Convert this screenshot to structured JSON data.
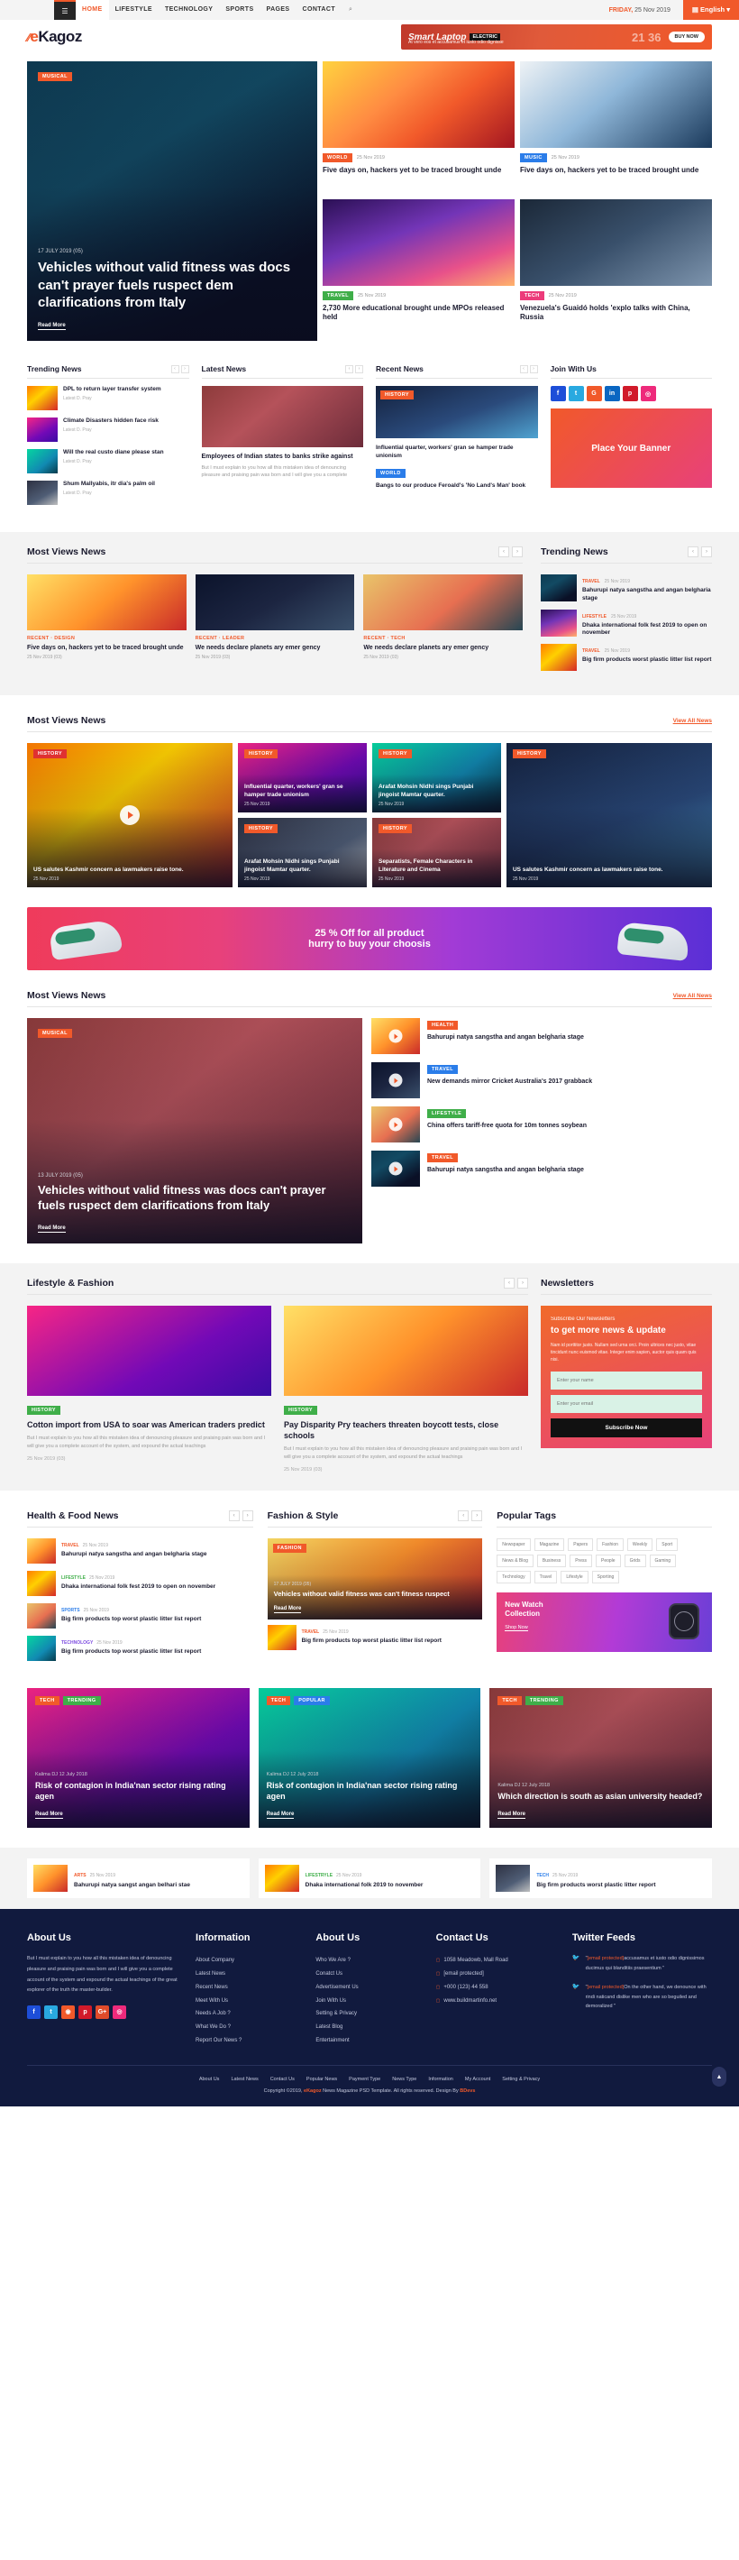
{
  "topbar": {
    "nav": [
      "HOME",
      "LIFESTYLE",
      "TECHNOLOGY",
      "SPORTS",
      "PAGES",
      "CONTACT"
    ],
    "search_icon": "search-icon",
    "date_day": "FRIDAY,",
    "date_rest": " 25 Nov 2019",
    "language": "English"
  },
  "header": {
    "logo_e": "e",
    "logo_rest": "Kagoz",
    "ad": {
      "title": "Smart Laptop",
      "chip": "ELECTRIC",
      "subtitle": "At vero eos et accusamus et iusto odio dignisse",
      "number": "21 36",
      "button": "BUY NOW"
    }
  },
  "hero": {
    "category": "MUSICAL",
    "meta": "17 JULY 2019   (05)",
    "title": "Vehicles without valid fitness was docs can't prayer fuels ruspect dem clarifications from Italy",
    "read_more": "Read More"
  },
  "hero_cards": [
    {
      "category": "WORLD",
      "cat_class": "c-or",
      "date": "25 Nov 2019",
      "title": "Five days on, hackers yet to be traced brought unde",
      "img": "g2"
    },
    {
      "category": "MUSIC",
      "cat_class": "c-bl",
      "date": "25 Nov 2019",
      "title": "Five days on, hackers yet to be traced brought unde",
      "img": "g3"
    },
    {
      "category": "TRAVEL",
      "cat_class": "c-gr",
      "date": "25 Nov 2019",
      "title": "2,730 More educational brought unde MPOs released held",
      "img": "g4"
    },
    {
      "category": "TECH",
      "cat_class": "c-pk",
      "date": "25 Nov 2019",
      "title": "Venezuela's Guaidó holds 'explo talks with China, Russia",
      "img": "g5"
    }
  ],
  "columns": {
    "trending": {
      "title": "Trending News",
      "items": [
        {
          "title": "DPL to return layer transfer system",
          "date": "Latest D. Pray",
          "img": "g6"
        },
        {
          "title": "Climate Disasters hidden face risk",
          "date": "Latest D. Pray",
          "img": "g7"
        },
        {
          "title": "Will the real custo diane please stan",
          "date": "Latest D. Pray",
          "img": "g8"
        },
        {
          "title": "Shum Mallyabis, itr dia's palm oil",
          "date": "Latest D. Pray",
          "img": "g9"
        }
      ]
    },
    "latest": {
      "title": "Latest News",
      "image": "g10",
      "title_text": "Employees of Indian states to banks strike against",
      "desc": "But I must explain to you how all this mistaken idea of denouncing pleasure and praising pain was born and I will give you a complete"
    },
    "recent": {
      "title": "Recent News",
      "image": "g11",
      "category": "HISTORY",
      "cat_class": "c-or",
      "title_text": "Influential quarter, workers' gran se hamper trade unionism",
      "sub_category": "WORLD",
      "sub_cat_class": "c-bl",
      "sub_title": "Bangs to our produce Feroald's 'No Land's Man' book"
    },
    "join": {
      "title": "Join With Us",
      "socials": [
        "f",
        "t",
        "g",
        "in",
        "p",
        "r"
      ],
      "banner": "Place Your Banner"
    }
  },
  "most_views_grey": {
    "title": "Most Views News",
    "items": [
      {
        "img": "g12",
        "cat": "RECENT · DESIGN",
        "title": "Five days on, hackers yet to be traced brought unde",
        "meta": "25 Nov 2019   (03)"
      },
      {
        "img": "g13",
        "cat": "RECENT · LEADER",
        "title": "We needs declare planets ary emer gency",
        "meta": "25 Nov 2019   (03)"
      },
      {
        "img": "g14",
        "cat": "RECENT · TECH",
        "title": "We needs declare planets ary emer gency",
        "meta": "25 Nov 2019   (03)"
      }
    ],
    "trending_title": "Trending News",
    "trending": [
      {
        "img": "g1",
        "cat": "TRAVEL",
        "date": "25 Nov 2019",
        "title": "Bahurupi natya sangstha and angan belgharia stage"
      },
      {
        "img": "g4",
        "cat": "LIFESTYLE",
        "date": "25 Nov 2019",
        "title": "Dhaka international folk fest 2019 to open on november"
      },
      {
        "img": "g6",
        "cat": "TRAVEL",
        "date": "25 Nov 2019",
        "title": "Big firm products worst plastic litter list report"
      }
    ]
  },
  "mosaic": {
    "title": "Most Views News",
    "view_all": "View All News",
    "tiles": [
      {
        "img": "g6",
        "cat": "HISTORY",
        "cat_class": "c-rd",
        "title": "US salutes Kashmir concern as lawmakers raise tone.",
        "date": "25 Nov 2019",
        "play": true
      },
      {
        "img": "g7",
        "cat": "HISTORY",
        "cat_class": "c-or",
        "title": "Influential quarter, workers' gran se hamper trade unionism",
        "date": "25 Nov 2019"
      },
      {
        "img": "g8",
        "cat": "HISTORY",
        "cat_class": "c-or",
        "title": "Arafat Mohsin Nidhi sings Punjabi jingoist Mamtar quarter.",
        "date": "25 Nov 2019"
      },
      {
        "img": "g9",
        "cat": "HISTORY",
        "cat_class": "c-or",
        "title": "Arafat Mohsin Nidhi sings Punjabi jingoist Mamtar quarter.",
        "date": "25 Nov 2019"
      },
      {
        "img": "g10",
        "cat": "HISTORY",
        "cat_class": "c-or",
        "title": "Separatists, Female Characters in Literature and Cinema",
        "date": "25 Nov 2019"
      },
      {
        "img": "g11",
        "cat": "HISTORY",
        "cat_class": "c-or",
        "title": "US salutes Kashmir concern as lawmakers raise tone.",
        "date": "25 Nov 2019"
      }
    ]
  },
  "promo": {
    "line1": "25 % Off for all product",
    "line2": "hurry to buy your choosis"
  },
  "feature": {
    "title": "Most Views News",
    "view_all": "View All News",
    "main": {
      "category": "MUSICAL",
      "cat_class": "c-or",
      "meta": "13 JULY 2019   (05)",
      "title": "Vehicles without valid fitness was docs can't prayer fuels ruspect dem clarifications from Italy",
      "read_more": "Read More",
      "img": "g10"
    },
    "list": [
      {
        "img": "g12",
        "cat": "HEALTH",
        "cat_class": "c-or",
        "title": "Bahurupi natya sangstha and angan belgharia stage"
      },
      {
        "img": "g13",
        "cat": "TRAVEL",
        "cat_class": "c-bl",
        "title": "New demands mirror Cricket Australia's 2017 grabback"
      },
      {
        "img": "g14",
        "cat": "LIFESTYLE",
        "cat_class": "c-gr",
        "title": "China offers tariff-free quota for 10m tonnes soybean"
      },
      {
        "img": "g1",
        "cat": "TRAVEL",
        "cat_class": "c-or",
        "title": "Bahurupi natya sangstha and angan belgharia stage"
      }
    ]
  },
  "lifestyle": {
    "title": "Lifestyle & Fashion",
    "cards": [
      {
        "img": "g7",
        "cat": "HISTORY",
        "cat_class": "c-gr",
        "title": "Cotton import from USA to soar was American traders predict",
        "desc": "But I must explain to you how all this mistaken idea of denouncing pleasure and praising pain was born and I will give you a complete account of the system, and expound the actual teachings",
        "meta": "25 Nov 2019   (03)"
      },
      {
        "img": "g12",
        "cat": "HISTORY",
        "cat_class": "c-gr",
        "title": "Pay Disparity Pry teachers threaten boycott tests, close schools",
        "desc": "But I must explain to you how all this mistaken idea of denouncing pleasure and praising pain was born and I will give you a complete account of the system, and expound the actual teachings",
        "meta": "25 Nov 2019   (03)"
      }
    ]
  },
  "newsletter": {
    "title": "Newsletters",
    "sub": "Subscribe Our Newsletters",
    "head": "to get more news & update",
    "desc": "Nam id porttitor justo. Nullam sed urna orci. Proin ultrices nec justo, vitae tincidunt nunc euismod vitae. Integer enim sapien, auctor quis quam quis nisi.",
    "input1_placeholder": "Enter your name",
    "input2_placeholder": "Enter your email",
    "button": "Subscribe Now"
  },
  "bottom3": {
    "health": {
      "title": "Health & Food News",
      "items": [
        {
          "img": "g12",
          "cat": "TRAVEL",
          "color": "#f1592a",
          "date": "25 Nov 2019",
          "title": "Bahurupi natya sangstha and angan belgharia stage"
        },
        {
          "img": "g6",
          "cat": "LIFESTYLE",
          "color": "#3fae49",
          "date": "25 Nov 2019",
          "title": "Dhaka international folk fest 2019 to open on november"
        },
        {
          "img": "g14",
          "cat": "SPORTS",
          "color": "#2b7de9",
          "date": "25 Nov 2019",
          "title": "Big firm products top worst plastic litter list report"
        },
        {
          "img": "g8",
          "cat": "TECHNOLOGY",
          "color": "#7d4ce0",
          "date": "25 Nov 2019",
          "title": "Big firm products top worst plastic litter list report"
        }
      ]
    },
    "fashion": {
      "title": "Fashion & Style",
      "main": {
        "img": "g12",
        "cat": "FASHION",
        "cat_class": "c-or",
        "meta": "17 JULY 2019   (05)",
        "title": "Vehicles without valid fitness was can't fitness ruspect",
        "read_more": "Read More"
      },
      "sub": {
        "img": "g6",
        "cat": "TRAVEL",
        "color": "#f1592a",
        "date": "25 Nov 2019",
        "title": "Big firm products top worst plastic litter list report"
      }
    },
    "tags": {
      "title": "Popular Tags",
      "items": [
        "Newspaper",
        "Magazine",
        "Papers",
        "Fashion",
        "Weekly",
        "Sport",
        "News & Blog",
        "Business",
        "Press",
        "People",
        "Grids",
        "Gaming",
        "Technology",
        "Travel",
        "Lifestyle",
        "Sporting"
      ],
      "watch": {
        "title": "New Watch\nCollection",
        "button": "Shop Now"
      }
    }
  },
  "big3": [
    {
      "img": "g7",
      "tags": [
        {
          "l": "TECH",
          "c": "c-or"
        },
        {
          "l": "TRENDING",
          "c": "c-gr"
        }
      ],
      "meta": "Kalima DJ   12 July 2018",
      "title": "Risk of contagion in India'nan sector rising rating agen",
      "read_more": "Read More"
    },
    {
      "img": "g8",
      "tags": [
        {
          "l": "TECH",
          "c": "c-or"
        },
        {
          "l": "POPULAR",
          "c": "c-bl"
        }
      ],
      "meta": "Kalima DJ   12 July 2018",
      "title": "Risk of contagion in India'nan sector rising rating agen",
      "read_more": "Read More"
    },
    {
      "img": "g10",
      "tags": [
        {
          "l": "TECH",
          "c": "c-or"
        },
        {
          "l": "TRENDING",
          "c": "c-gr"
        }
      ],
      "meta": "Kalima DJ   12 July 2018",
      "title": "Which direction is south as asian university headed?",
      "read_more": "Read More"
    }
  ],
  "strip": [
    {
      "img": "g12",
      "cat": "ARTS",
      "color": "#f1592a",
      "date": "25 Nov 2019",
      "title": "Bahurupi natya sangst angan belhari stae"
    },
    {
      "img": "g6",
      "cat": "LIFESTRYLE",
      "color": "#3fae49",
      "date": "25 Nov 2019",
      "title": "Dhaka international folk 2019 to november"
    },
    {
      "img": "g9",
      "cat": "TECH",
      "color": "#2b7de9",
      "date": "25 Nov 2019",
      "title": "Big firm products worst plastic litter report"
    }
  ],
  "footer": {
    "about": {
      "title": "About Us",
      "text": "But I must explain to you how all this mistaken idea of denouncing pleasure and praising pain was born and I will give you a complete account of the system and expound the actual teachings of the great explorer of the truth the master-builder.",
      "socials": [
        {
          "g": "f",
          "c": "#1d4ed8"
        },
        {
          "g": "t",
          "c": "#29a9e0"
        },
        {
          "g": "◉",
          "c": "#f1592a"
        },
        {
          "g": "p",
          "c": "#d11a2a"
        },
        {
          "g": "G+",
          "c": "#e04b2a"
        },
        {
          "g": "◎",
          "c": "#ee2a7b"
        }
      ]
    },
    "information": {
      "title": "Information",
      "links": [
        "About Company",
        "Latest News",
        "Recent News",
        "Meet With Us",
        "Needs A Job ?",
        "What We Do ?",
        "Report Our News ?"
      ]
    },
    "about2": {
      "title": "About Us",
      "links": [
        "Who We Are ?",
        "Conatct Us",
        "Advertisement Us",
        "Join With Us",
        "Setting & Privacy",
        "Latest Blog",
        "Entertainment"
      ]
    },
    "contact": {
      "title": "Contact Us",
      "items": [
        "1058 Meadowb, Mall Road",
        "[email protected]",
        "+000 (123) 44 558",
        "www.buildmartinfo.net"
      ]
    },
    "twitter": {
      "title": "Twitter Feeds",
      "feeds": [
        {
          "handle": "[email protected]",
          "text": "accusamus et iusto odio dignissimos ducimus qui blanditiis praesentium \""
        },
        {
          "handle": "[email protected]",
          "text": "On the other hand, we denounce with rindi naticand dislike men who are so beguiled and demoralized \""
        }
      ]
    },
    "bottom_links": [
      "About Us",
      "Latest News",
      "Contact Us",
      "Popular News",
      "Payment Type",
      "News Type",
      "Information",
      "My Account",
      "Setting & Privacy"
    ],
    "copyright_pre": "Copyright ©2019,",
    "copyright_brand": "eKagoz",
    "copyright_mid": "News Magazine PSD Template. All rights reserved. Design By",
    "copyright_brand2": "BDevs"
  }
}
